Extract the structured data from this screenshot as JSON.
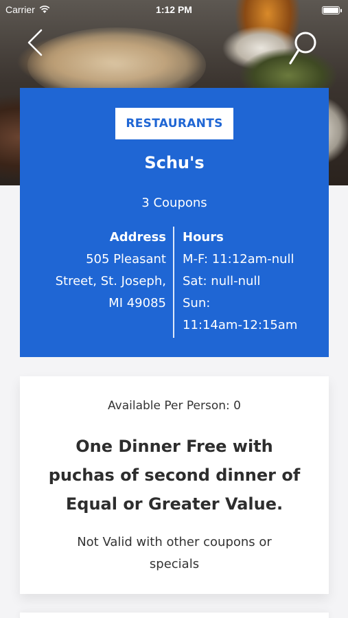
{
  "status_bar": {
    "carrier": "Carrier",
    "time": "1:12 PM"
  },
  "header": {
    "back_icon": "chevron-left-icon",
    "search_icon": "search-icon"
  },
  "restaurant": {
    "category": "RESTAURANTS",
    "name": "Schu's",
    "coupons": "3 Coupons",
    "address_heading": "Address",
    "address_lines": [
      "505 Pleasant",
      "Street, St. Joseph,",
      "MI 49085"
    ],
    "hours_heading": "Hours",
    "hours_lines": [
      "M-F: 11:12am-null",
      "Sat: null-null",
      "Sun:",
      "11:14am-12:15am"
    ]
  },
  "coupon": {
    "available": "Available Per Person: 0",
    "offer_lines": [
      "One Dinner Free with",
      "puchas of second dinner of",
      "Equal or Greater Value."
    ],
    "restriction_lines": [
      "Not Valid with other coupons or",
      "specials"
    ]
  },
  "colors": {
    "brand_blue": "#1f66d4",
    "card_white": "#ffffff",
    "page_bg": "#f4f4f6"
  }
}
